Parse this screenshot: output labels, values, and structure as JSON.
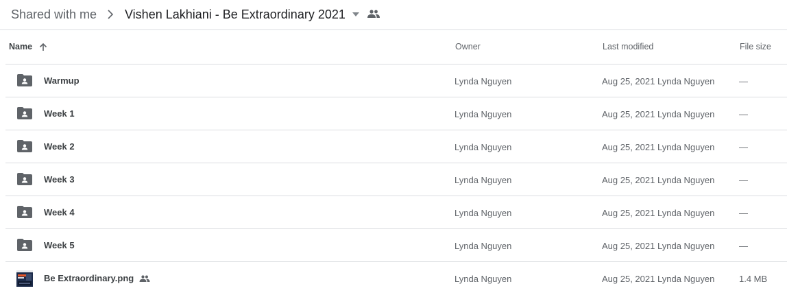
{
  "breadcrumb": {
    "root": "Shared with me",
    "current": "Vishen Lakhiani - Be Extraordinary 2021"
  },
  "columns": {
    "name": "Name",
    "owner": "Owner",
    "last_modified": "Last modified",
    "file_size": "File size"
  },
  "colors": {
    "folder_icon": "#5f6368",
    "text_secondary": "#5f6368",
    "divider": "#dadce0"
  },
  "files": [
    {
      "name": "Warmup",
      "type": "shared-folder",
      "owner": "Lynda Nguyen",
      "modified_date": "Aug 25, 2021",
      "modified_by": "Lynda Nguyen",
      "size": "—"
    },
    {
      "name": "Week 1",
      "type": "shared-folder",
      "owner": "Lynda Nguyen",
      "modified_date": "Aug 25, 2021",
      "modified_by": "Lynda Nguyen",
      "size": "—"
    },
    {
      "name": "Week 2",
      "type": "shared-folder",
      "owner": "Lynda Nguyen",
      "modified_date": "Aug 25, 2021",
      "modified_by": "Lynda Nguyen",
      "size": "—"
    },
    {
      "name": "Week 3",
      "type": "shared-folder",
      "owner": "Lynda Nguyen",
      "modified_date": "Aug 25, 2021",
      "modified_by": "Lynda Nguyen",
      "size": "—"
    },
    {
      "name": "Week 4",
      "type": "shared-folder",
      "owner": "Lynda Nguyen",
      "modified_date": "Aug 25, 2021",
      "modified_by": "Lynda Nguyen",
      "size": "—"
    },
    {
      "name": "Week 5",
      "type": "shared-folder",
      "owner": "Lynda Nguyen",
      "modified_date": "Aug 25, 2021",
      "modified_by": "Lynda Nguyen",
      "size": "—"
    },
    {
      "name": "Be Extraordinary.png",
      "type": "image",
      "owner": "Lynda Nguyen",
      "modified_date": "Aug 25, 2021",
      "modified_by": "Lynda Nguyen",
      "size": "1.4 MB"
    }
  ]
}
